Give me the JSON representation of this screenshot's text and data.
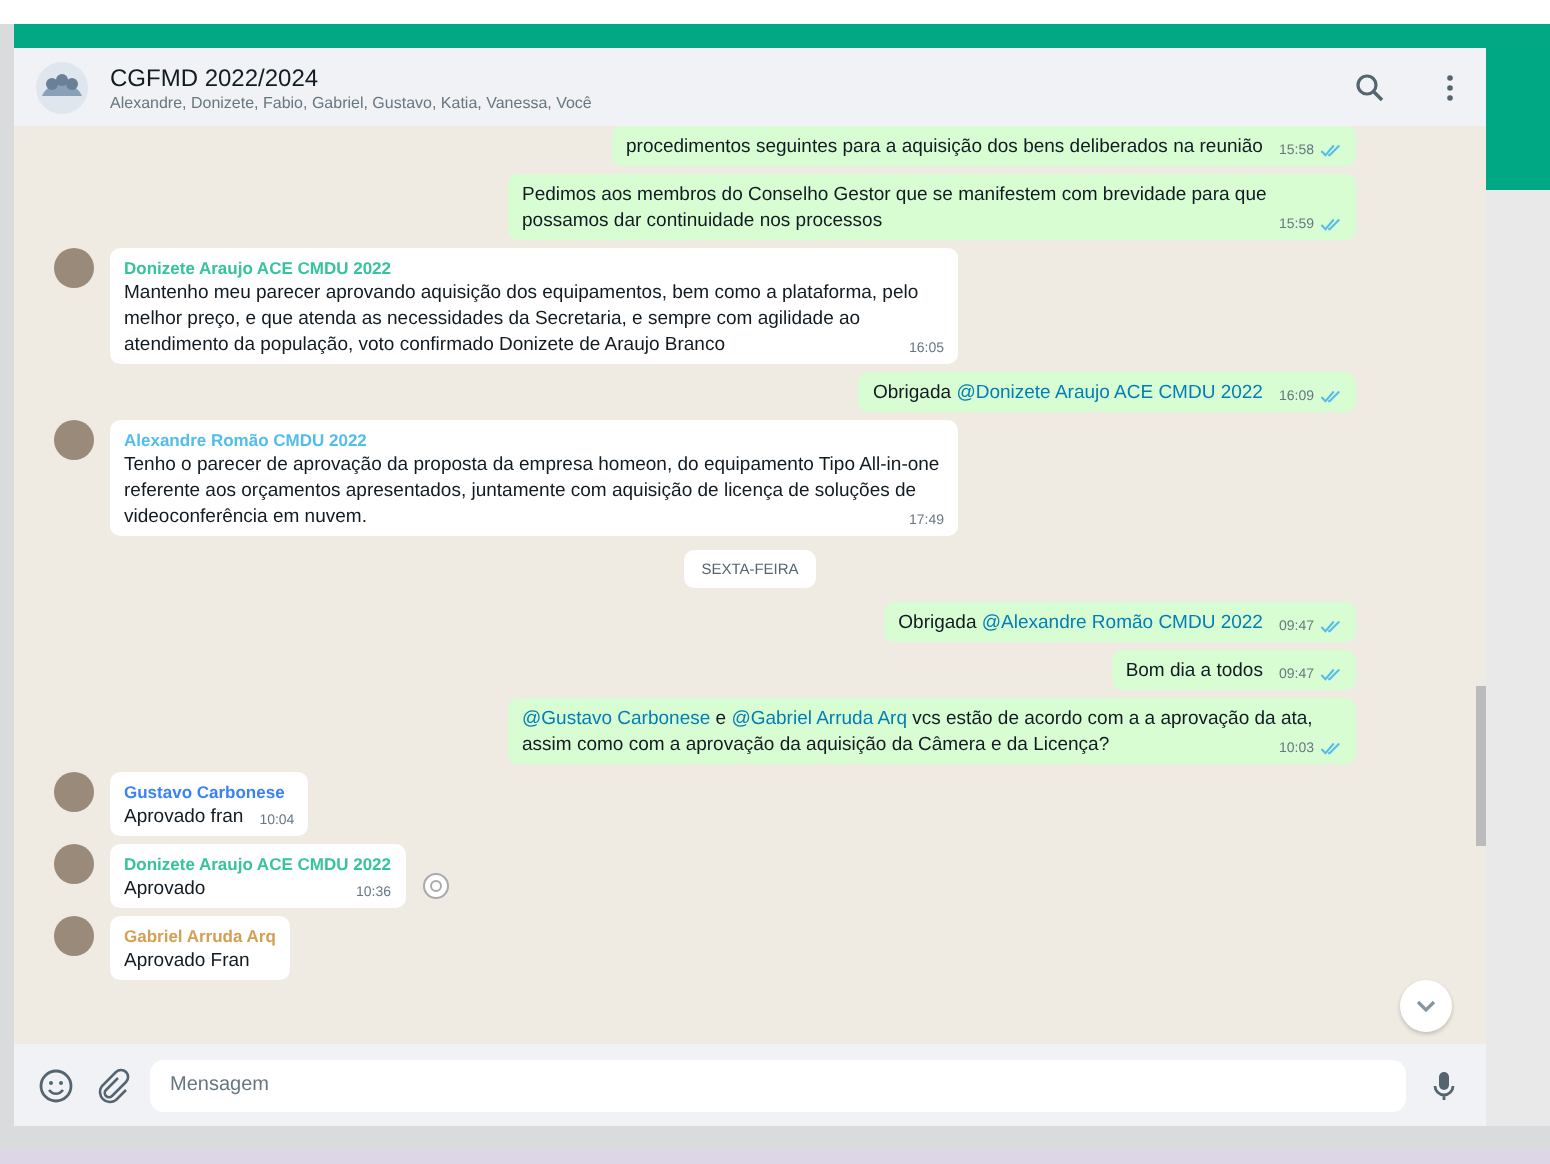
{
  "header": {
    "title": "CGFMD 2022/2024",
    "members": "Alexandre, Donizete, Fabio, Gabriel, Gustavo, Katia, Vanessa, Você"
  },
  "messages": [
    {
      "kind": "out",
      "parts": [
        {
          "text": "procedimentos seguintes para a aquisição dos bens deliberados na reunião"
        }
      ],
      "time": "15:58"
    },
    {
      "kind": "out",
      "parts": [
        {
          "text": "Pedimos aos membros do Conselho Gestor que se manifestem com brevidade para que possamos dar continuidade nos processos"
        }
      ],
      "time": "15:59"
    },
    {
      "kind": "in",
      "sender": "Donizete Araujo ACE CMDU 2022",
      "color": "#35c3a0",
      "parts": [
        {
          "text": "Mantenho meu parecer aprovando aquisição dos equipamentos,  bem como a plataforma, pelo melhor preço, e que atenda as necessidades da Secretaria, e sempre com agilidade ao atendimento da população, voto confirmado Donizete de Araujo Branco"
        }
      ],
      "time": "16:05"
    },
    {
      "kind": "out",
      "parts": [
        {
          "text": "Obrigada "
        },
        {
          "text": "@Donizete Araujo ACE CMDU 2022",
          "mention": true
        }
      ],
      "time": "16:09"
    },
    {
      "kind": "in",
      "sender": "Alexandre Romão CMDU 2022",
      "color": "#53bdeb",
      "parts": [
        {
          "text": "Tenho o parecer de aprovação da proposta da empresa homeon, do equipamento Tipo All-in-one referente aos orçamentos apresentados, juntamente com aquisição de licença de soluções de videoconferência em nuvem."
        }
      ],
      "time": "17:49"
    },
    {
      "kind": "date",
      "text": "SEXTA-FEIRA"
    },
    {
      "kind": "out",
      "parts": [
        {
          "text": "Obrigada "
        },
        {
          "text": "@Alexandre Romão CMDU 2022",
          "mention": true
        }
      ],
      "time": "09:47"
    },
    {
      "kind": "out",
      "parts": [
        {
          "text": "Bom dia a todos"
        }
      ],
      "time": "09:47"
    },
    {
      "kind": "out",
      "parts": [
        {
          "text": "@Gustavo Carbonese",
          "mention": true
        },
        {
          "text": " e "
        },
        {
          "text": "@Gabriel Arruda Arq",
          "mention": true
        },
        {
          "text": " vcs estão de acordo com a a aprovação da ata, assim como com a aprovação da aquisição da Câmera e da Licença?"
        }
      ],
      "time": "10:03"
    },
    {
      "kind": "in",
      "sender": "Gustavo Carbonese",
      "color": "#3b82f6",
      "parts": [
        {
          "text": "Aprovado fran"
        }
      ],
      "time": "10:04"
    },
    {
      "kind": "in",
      "sender": "Donizete Araujo ACE CMDU 2022",
      "color": "#35c3a0",
      "parts": [
        {
          "text": "Aprovado"
        }
      ],
      "time": "10:36",
      "react": true
    },
    {
      "kind": "in",
      "sender": "Gabriel Arruda Arq",
      "color": "#d4a056",
      "parts": [
        {
          "text": "Aprovado Fran"
        }
      ]
    }
  ],
  "composer": {
    "placeholder": "Mensagem"
  }
}
